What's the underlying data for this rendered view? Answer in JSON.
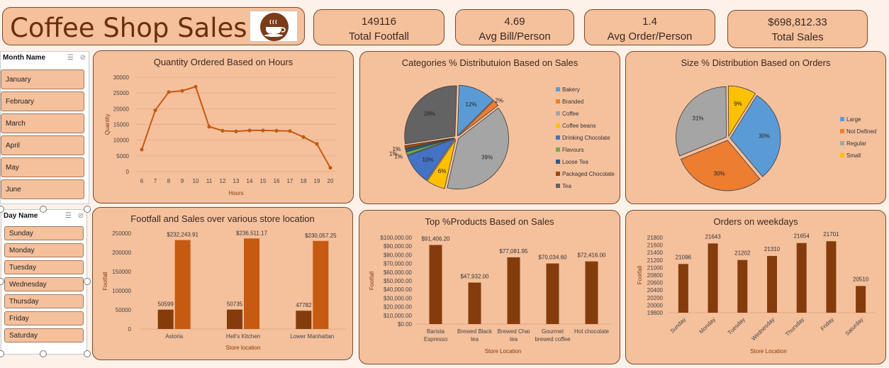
{
  "header": {
    "title": "Coffee Shop Sales",
    "logo_icon": "coffee-cup-icon"
  },
  "kpis": [
    {
      "value": "149116",
      "label": "Total Footfall"
    },
    {
      "value": "4.69",
      "label": "Avg Bill/Person"
    },
    {
      "value": "1.4",
      "label": "Avg Order/Person"
    },
    {
      "value": "$698,812.33",
      "label": "Total Sales"
    }
  ],
  "month_slicer": {
    "title": "Month Name",
    "items": [
      "January",
      "February",
      "March",
      "April",
      "May",
      "June"
    ]
  },
  "day_slicer": {
    "title": "Day Name",
    "items": [
      "Sunday",
      "Monday",
      "Tuesday",
      "Wednesday",
      "Thursday",
      "Friday",
      "Saturday"
    ]
  },
  "colors": {
    "accent": "#c55a11",
    "dark_bar": "#843c0c",
    "panel": "#f5c09c"
  },
  "chart_data": [
    {
      "type": "line",
      "title": "Quantity Ordered Based on Hours",
      "xlabel": "Hours",
      "ylabel": "Quantity",
      "x": [
        6,
        7,
        8,
        9,
        10,
        11,
        12,
        13,
        14,
        15,
        16,
        17,
        18,
        19,
        20
      ],
      "values": [
        7000,
        19500,
        25300,
        25700,
        27000,
        14300,
        13000,
        12800,
        13100,
        13100,
        13000,
        12900,
        11000,
        8800,
        1200
      ],
      "yticks": [
        "0",
        "5000",
        "10000",
        "15000",
        "20000",
        "25000",
        "30000"
      ],
      "ylim": [
        0,
        30000
      ],
      "color": "#c55a11"
    },
    {
      "type": "pie",
      "title": "Categories % Distributuion Based on Sales",
      "labels": [
        "Bakery",
        "Branded",
        "Coffee",
        "Coffee beans",
        "Drinking Chocolate",
        "Flavours",
        "Loose Tea",
        "Packaged Chocolate",
        "Tea"
      ],
      "values": [
        12,
        2,
        39,
        6,
        10,
        1,
        1,
        1,
        28
      ],
      "data_labels": [
        "12%",
        "2%",
        "39%",
        "6%",
        "10%",
        "1%",
        "1%",
        "1%",
        "28%"
      ],
      "colors": [
        "#5b9bd5",
        "#ed7d31",
        "#a5a5a5",
        "#ffc000",
        "#4472c4",
        "#70ad47",
        "#255e91",
        "#9e480e",
        "#636363"
      ]
    },
    {
      "type": "pie",
      "title": "Size % Distribution Based on Orders",
      "labels": [
        "Large",
        "Not Defined",
        "Regular",
        "Small"
      ],
      "values": [
        30,
        30,
        31,
        9
      ],
      "data_labels": [
        "30%",
        "30%",
        "31%",
        "9%"
      ],
      "colors": [
        "#5b9bd5",
        "#ed7d31",
        "#a5a5a5",
        "#ffc000"
      ]
    },
    {
      "type": "bar",
      "title": "Footfall and Sales over various store location",
      "categories": [
        "Astoria",
        "Hell's Kitchen",
        "Lower Manhattan"
      ],
      "series": [
        {
          "values": [
            50599,
            50735,
            47782
          ],
          "labels": [
            "50599",
            "50735",
            "47782"
          ],
          "color": "#843c0c"
        },
        {
          "values": [
            232243.91,
            236511.17,
            230057.25
          ],
          "labels": [
            "$232,243.91",
            "$236,511.17",
            "$230,057.25"
          ],
          "color": "#c55a11"
        }
      ],
      "xlabel": "Store location",
      "ylabel": "Footfall",
      "yticks": [
        "0",
        "50000",
        "100000",
        "150000",
        "200000",
        "250000"
      ],
      "ylim": [
        0,
        250000
      ]
    },
    {
      "type": "bar",
      "title": "Top %Products Based on Sales",
      "categories": [
        [
          "Barista",
          "Espresso"
        ],
        [
          "Brewed Black",
          "tea"
        ],
        [
          "Brewed Chai",
          "tea"
        ],
        [
          "Gourmet",
          "brewed coffee"
        ],
        [
          "Hot chocolate"
        ]
      ],
      "values": [
        91406.2,
        47932.0,
        77081.95,
        70034.6,
        72416.0
      ],
      "labels": [
        "$91,406.20",
        "$47,932.00",
        "$77,081.95",
        "$70,034.60",
        "$72,416.00"
      ],
      "xlabel": "Store Location",
      "ylabel": "Footfall",
      "yticks": [
        "$0.00",
        "$10,000.00",
        "$20,000.00",
        "$30,000.00",
        "$40,000.00",
        "$50,000.00",
        "$60,000.00",
        "$70,000.00",
        "$80,000.00",
        "$90,000.00",
        "$100,000.00"
      ],
      "ylim": [
        0,
        100000
      ],
      "color": "#843c0c"
    },
    {
      "type": "bar",
      "title": "Orders on weekdays",
      "categories": [
        "Sunday",
        "Monday",
        "Tuesday",
        "Wednesday",
        "Thursday",
        "Friday",
        "Saturday"
      ],
      "values": [
        21096,
        21643,
        21202,
        21310,
        21654,
        21701,
        20510
      ],
      "labels": [
        "21096",
        "21643",
        "21202",
        "21310",
        "21654",
        "21701",
        "20510"
      ],
      "xlabel": "Store Location",
      "ylabel": "Footfall",
      "yticks": [
        "19800",
        "20000",
        "20200",
        "20400",
        "20600",
        "20800",
        "21000",
        "21200",
        "21400",
        "21600",
        "21800"
      ],
      "ylim": [
        19800,
        21800
      ],
      "color": "#843c0c"
    }
  ]
}
